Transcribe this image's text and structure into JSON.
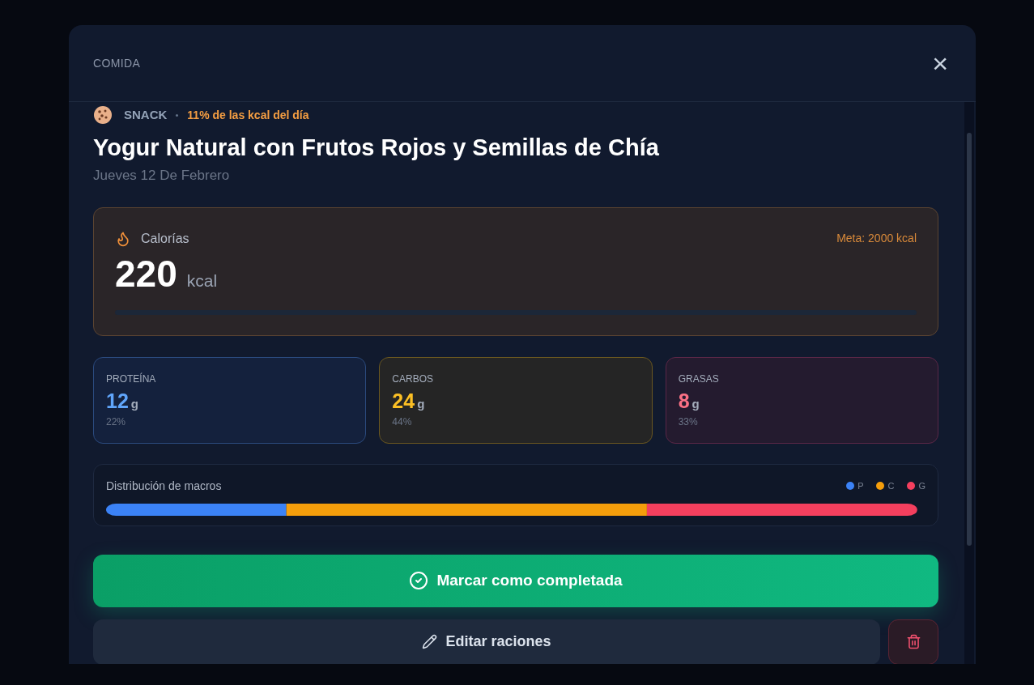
{
  "modal": {
    "title": "COMIDA",
    "close": "×"
  },
  "meal": {
    "type": "SNACK",
    "share": "11% de las kcal del día",
    "name": "Yogur Natural con Frutos Rojos y Semillas de Chía",
    "date": "Jueves 12 De Febrero"
  },
  "calories": {
    "label": "Calorías",
    "goal": "Meta: 2000 kcal",
    "value": "220",
    "unit": "kcal"
  },
  "macros": [
    {
      "kind": "protein",
      "label": "PROTEÍNA",
      "value": "12",
      "unit": "g",
      "percent": "22%"
    },
    {
      "kind": "carbs",
      "label": "CARBOS",
      "value": "24",
      "unit": "g",
      "percent": "44%"
    },
    {
      "kind": "fat",
      "label": "GRASAS",
      "value": "8",
      "unit": "g",
      "percent": "33%"
    }
  ],
  "distribution": {
    "title": "Distribución de macros",
    "legend": [
      {
        "label": "P",
        "color": "#3b82f6"
      },
      {
        "label": "C",
        "color": "#f59e0b"
      },
      {
        "label": "G",
        "color": "#f43f5e"
      }
    ]
  },
  "actions": {
    "complete": "Marcar como completada",
    "edit": "Editar raciones"
  }
}
